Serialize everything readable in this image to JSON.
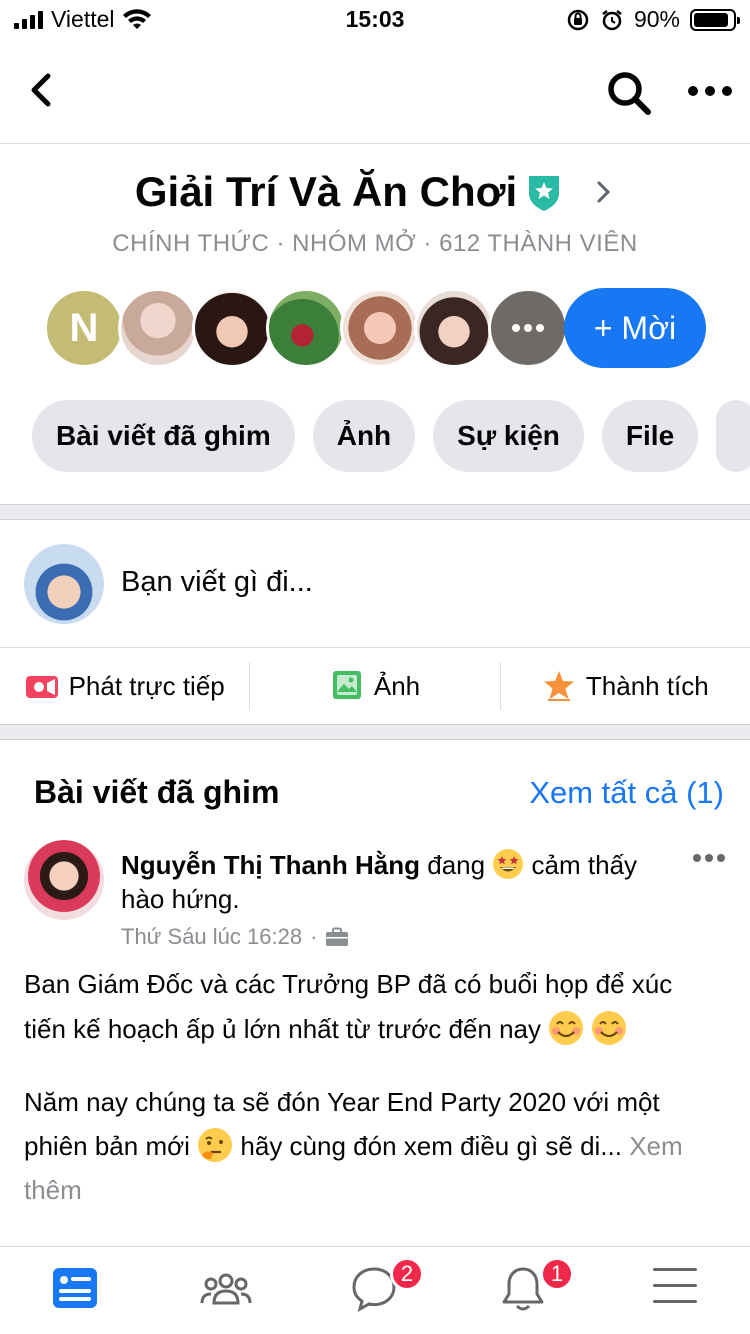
{
  "status_bar": {
    "carrier": "Viettel",
    "time": "15:03",
    "battery_percent": "90%",
    "battery_level": 0.9
  },
  "nav": {
    "back_label": "Back",
    "search_label": "Search",
    "more_label": "More"
  },
  "group": {
    "title": "Giải Trí Và Ăn Chơi",
    "meta": "CHÍNH THỨC · NHÓM MỞ · 612 THÀNH VIÊN",
    "first_member_initial": "N",
    "invite_label": "+ Mời"
  },
  "chips": [
    "Bài viết đã ghim",
    "Ảnh",
    "Sự kiện",
    "File"
  ],
  "composer": {
    "prompt": "Bạn viết gì đi..."
  },
  "actions": {
    "live": "Phát trực tiếp",
    "photo": "Ảnh",
    "achievement": "Thành tích"
  },
  "pinned": {
    "title": "Bài viết đã ghim",
    "see_all": "Xem tất cả (1)"
  },
  "post": {
    "author": "Nguyễn Thị Thanh Hằng",
    "feeling_prefix": "đang",
    "feeling": "cảm thấy hào hứng.",
    "time": "Thứ Sáu lúc 16:28",
    "paragraph1": "Ban Giám Đốc và các Trưởng BP đã có buổi họp để xúc tiến kế hoạch ấp ủ lớn nhất từ trước đến nay",
    "paragraph2_a": "Năm nay chúng ta sẽ đón Year End Party 2020 với một phiên bản mới",
    "paragraph2_b": "hãy cùng đón xem điều gì sẽ di...",
    "see_more": "Xem thêm"
  },
  "tab_bar": {
    "messages_badge": "2",
    "notifications_badge": "1"
  },
  "colors": {
    "accent": "#1877f2",
    "badge": "#f02849",
    "live": "#f3425f",
    "photo": "#45bd62",
    "achievement": "#f7923b",
    "shield": "#2abba7"
  }
}
